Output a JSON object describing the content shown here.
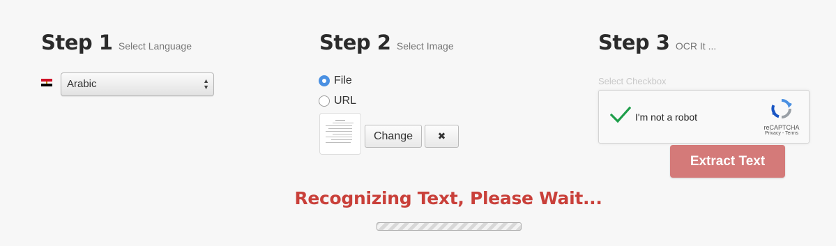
{
  "step1": {
    "title": "Step 1",
    "subtitle": "Select Language",
    "language_value": "Arabic"
  },
  "step2": {
    "title": "Step 2",
    "subtitle": "Select Image",
    "source_options": [
      {
        "label": "File",
        "checked": true
      },
      {
        "label": "URL",
        "checked": false
      }
    ],
    "change_label": "Change",
    "remove_label": "✖"
  },
  "step3": {
    "title": "Step 3",
    "subtitle": "OCR It ...",
    "checkbox_hint": "Select Checkbox",
    "recaptcha_label": "I'm not a robot",
    "recaptcha_brand": "reCAPTCHA",
    "recaptcha_links": "Privacy - Terms",
    "extract_label": "Extract Text"
  },
  "status": {
    "message": "Recognizing Text, Please Wait..."
  },
  "colors": {
    "accent_radio": "#4a90e2",
    "extract_button": "#d47a79",
    "status_text": "#c9403a",
    "check_green": "#1e9e4a"
  },
  "icons": {
    "flag": "egypt-flag-icon",
    "select_arrows": "updown-arrows-icon",
    "remove": "close-icon",
    "captcha_check": "checkmark-icon",
    "captcha_logo": "recaptcha-logo-icon"
  }
}
